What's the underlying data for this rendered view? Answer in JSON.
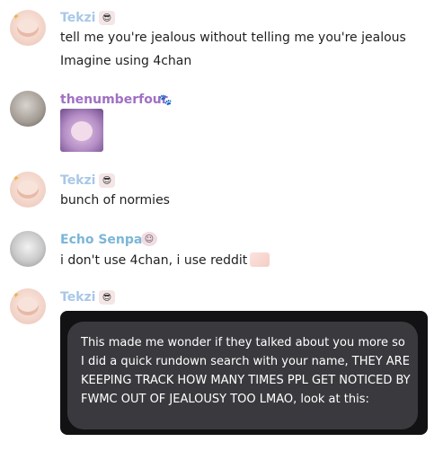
{
  "messages": [
    {
      "author": "Tekzi",
      "lines": [
        "tell me you're jealous without telling me you're jealous",
        "Imagine using 4chan"
      ]
    },
    {
      "author": "thenumberfour",
      "attachment": "image-thumbnail"
    },
    {
      "author": "Tekzi",
      "lines": [
        "bunch of normies"
      ]
    },
    {
      "author": "Echo Senpai",
      "lines": [
        "i don't use 4chan, i use reddit"
      ]
    },
    {
      "author": "Tekzi",
      "quote": "This made me wonder if they talked about you more so I did a quick rundown search with your name, THEY ARE KEEPING TRACK HOW MANY TIMES PPL GET NOTICED BY FWMC OUT OF JEALOUSY TOO LMAO, look at this:"
    }
  ],
  "colors": {
    "tekzi_name": "#a9c7e8",
    "number_name": "#a070c4",
    "echo_name": "#7ab6d8",
    "embed_bg": "#121214",
    "bubble_bg": "#3a3a3e"
  },
  "icons": {
    "tekzi_badge": "sunglasses-cat-emoji",
    "number_badge": "paw-prints-icon",
    "echo_badge": "character-emoji"
  }
}
